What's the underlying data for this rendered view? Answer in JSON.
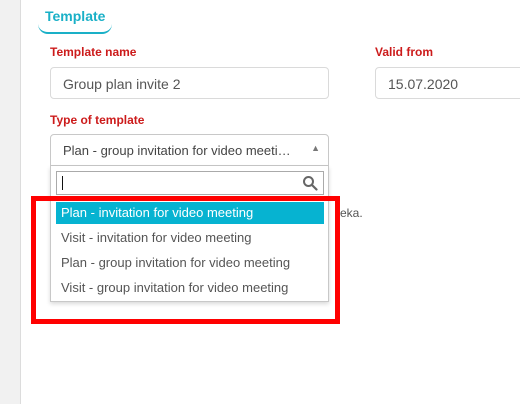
{
  "tab": {
    "label": "Template"
  },
  "form": {
    "template_name_label": "Template name",
    "template_name_value": "Group plan invite 2",
    "valid_from_label": "Valid from",
    "valid_from_value": "15.07.2020",
    "type_label": "Type of template",
    "type_selected": "Plan - group invitation for video meeti…"
  },
  "dropdown": {
    "search_value": "",
    "options": [
      {
        "label": "Plan - invitation for video meeting",
        "highlighted": true
      },
      {
        "label": "Visit - invitation for video meeting",
        "highlighted": false
      },
      {
        "label": "Plan - group invitation for video meeting",
        "highlighted": false
      },
      {
        "label": "Visit - group invitation for video meeting",
        "highlighted": false
      }
    ]
  },
  "partial_text": "eka.",
  "colors": {
    "accent": "#1ab0c7",
    "label_red": "#cc1b1b",
    "highlight": "#06b3d1",
    "annotation": "#ff0000"
  },
  "icons": {
    "search": "search-icon",
    "caret": "caret-up-icon"
  }
}
